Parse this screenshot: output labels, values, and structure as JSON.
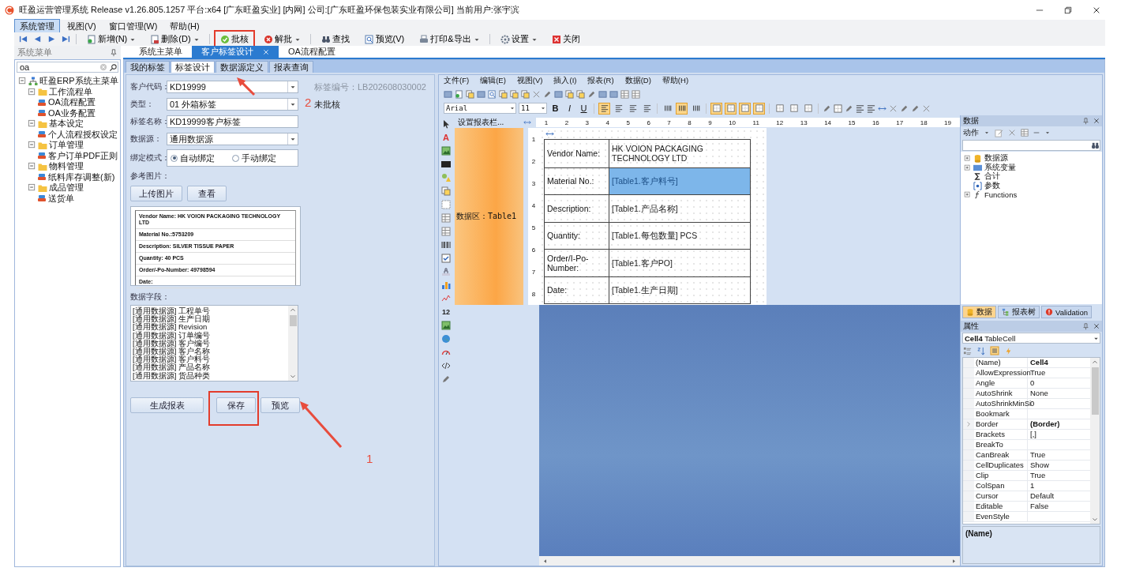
{
  "window": {
    "title": "旺盈运营管理系统 Release v1.26.805.1257 平台:x64  [广东旺盈实业] [内网] 公司:[广东旺盈环保包装实业有限公司] 当前用户:张宇滨"
  },
  "menu": [
    {
      "label": "系统管理",
      "selected": true
    },
    {
      "label": "视图(V)",
      "selected": false
    },
    {
      "label": "窗口管理(W)",
      "selected": false
    },
    {
      "label": "帮助(H)",
      "selected": false
    }
  ],
  "toolbar": [
    {
      "label": "新增(N)",
      "dropdown": true,
      "highlighted": false
    },
    {
      "label": "删除(D)",
      "dropdown": true,
      "highlighted": false
    },
    {
      "label": "批核",
      "dropdown": false,
      "highlighted": true
    },
    {
      "label": "解批",
      "dropdown": true,
      "highlighted": false
    },
    {
      "label": "查找",
      "dropdown": false,
      "highlighted": false
    },
    {
      "label": "预览(V)",
      "dropdown": false,
      "highlighted": false
    },
    {
      "label": "打印&导出",
      "dropdown": true,
      "highlighted": false
    },
    {
      "label": "设置",
      "dropdown": true,
      "highlighted": false
    },
    {
      "label": "关闭",
      "dropdown": false,
      "highlighted": false
    }
  ],
  "sidebar": {
    "title": "系统菜单",
    "search": {
      "value": "oa"
    },
    "tree": [
      {
        "label": "旺盈ERP系统主菜单",
        "kind": "root",
        "expanded": true,
        "children": [
          {
            "label": "工作流程单",
            "kind": "folder",
            "expanded": true,
            "children": [
              {
                "label": "OA流程配置",
                "kind": "leaf"
              },
              {
                "label": "OA业务配置",
                "kind": "leaf"
              }
            ]
          },
          {
            "label": "基本设定",
            "kind": "folder",
            "expanded": true,
            "children": [
              {
                "label": "个人流程授权设定",
                "kind": "leaf"
              }
            ]
          },
          {
            "label": "订单管理",
            "kind": "folder",
            "expanded": true,
            "children": [
              {
                "label": "客户订单PDF正则",
                "kind": "leaf"
              }
            ]
          },
          {
            "label": "物料管理",
            "kind": "folder",
            "expanded": true,
            "children": [
              {
                "label": "纸料库存调整(新)",
                "kind": "leaf"
              }
            ]
          },
          {
            "label": "成品管理",
            "kind": "folder",
            "expanded": true,
            "children": [
              {
                "label": "送货单",
                "kind": "leaf"
              }
            ]
          }
        ]
      }
    ]
  },
  "doc_tabs": [
    {
      "label": "系统主菜单",
      "selected": false,
      "closable": false
    },
    {
      "label": "客户标签设计",
      "selected": true,
      "closable": true
    },
    {
      "label": "OA流程配置",
      "selected": false,
      "closable": false
    }
  ],
  "inner_tabs": [
    {
      "label": "我的标签",
      "selected": false
    },
    {
      "label": "标签设计",
      "selected": true
    },
    {
      "label": "数据源定义",
      "selected": false
    },
    {
      "label": "报表查询",
      "selected": false
    }
  ],
  "form": {
    "fields": [
      {
        "label": "客户代码：",
        "kind": "select",
        "value": "KD19999"
      },
      {
        "label": "类型：",
        "kind": "select",
        "value": "01 外箱标签"
      },
      {
        "label": "标签名称：",
        "kind": "text",
        "value": "KD19999客户标签"
      },
      {
        "label": "数据源：",
        "kind": "select",
        "value": "通用数据源"
      },
      {
        "label": "绑定模式：",
        "kind": "radio",
        "options": [
          {
            "label": "自动绑定",
            "selected": true
          },
          {
            "label": "手动绑定",
            "selected": false
          }
        ]
      }
    ],
    "label_no": "标签编号：LB202608030002",
    "status": "未批核",
    "image_label": "参考图片：",
    "image_buttons": [
      "上传图片",
      "查看"
    ],
    "preview_lines": [
      "Vendor Name: HK VOION PACKAGING TECHNOLOGY LTD",
      "Material No.:5753209",
      "Description: SILVER TISSUE PAPER",
      "Quantity: 40 PCS",
      "Order/-Po-Number: 49798594",
      "Date:"
    ],
    "fields_label": "数据字段：",
    "data_fields": [
      "[通用数据源] 工程单号",
      "[通用数据源] 生产日期",
      "[通用数据源] Revision",
      "[通用数据源] 订单编号",
      "[通用数据源] 客户编号",
      "[通用数据源] 客户名称",
      "[通用数据源] 客户料号",
      "[通用数据源] 产品名称",
      "[通用数据源] 货品种类"
    ],
    "buttons": [
      {
        "label": "生成报表",
        "highlighted": false
      },
      {
        "label": "保存",
        "highlighted": true
      },
      {
        "label": "预览",
        "highlighted": false
      }
    ]
  },
  "designer": {
    "menu": [
      "文件(F)",
      "编辑(E)",
      "视图(V)",
      "插入(I)",
      "报表(R)",
      "数据(D)",
      "帮助(H)"
    ],
    "font": "Arial",
    "font_size": "11",
    "format_buttons": [
      {
        "kind": "letter",
        "glyph": "B",
        "selected": false
      },
      {
        "kind": "letter",
        "glyph": "I",
        "selected": false
      },
      {
        "kind": "letter",
        "glyph": "U",
        "selected": false
      },
      {
        "kind": "align",
        "selected": true
      },
      {
        "kind": "align",
        "selected": false
      },
      {
        "kind": "align",
        "selected": false
      },
      {
        "kind": "align",
        "selected": false
      },
      {
        "kind": "columns",
        "selected": false
      },
      {
        "kind": "columns",
        "selected": true
      },
      {
        "kind": "columns",
        "selected": false
      },
      {
        "kind": "border",
        "selected": true
      },
      {
        "kind": "border",
        "selected": true
      },
      {
        "kind": "border",
        "selected": true
      },
      {
        "kind": "border",
        "selected": true
      },
      {
        "kind": "border",
        "selected": false
      },
      {
        "kind": "border",
        "selected": false
      },
      {
        "kind": "border",
        "selected": false
      }
    ],
    "toolbox": [
      {
        "kind": "pointer"
      },
      {
        "kind": "letter",
        "glyph": "A"
      },
      {
        "kind": "image"
      },
      {
        "kind": "svg"
      },
      {
        "kind": "shape"
      },
      {
        "kind": "page"
      },
      {
        "kind": "panel"
      },
      {
        "kind": "table"
      },
      {
        "kind": "cross"
      },
      {
        "kind": "barcode"
      },
      {
        "kind": "check"
      },
      {
        "kind": "stamp"
      },
      {
        "kind": "chart"
      },
      {
        "kind": "spark"
      },
      {
        "kind": "letter",
        "glyph": "12"
      },
      {
        "kind": "image"
      },
      {
        "kind": "globe"
      },
      {
        "kind": "gauge"
      },
      {
        "kind": "code"
      },
      {
        "kind": "pen"
      }
    ],
    "band_header": "设置报表栏...",
    "band_label": "数据区：Table1",
    "ruler": [
      "1",
      "2",
      "3",
      "4",
      "5",
      "6",
      "7",
      "8",
      "9",
      "10",
      "11",
      "12",
      "13",
      "14",
      "15",
      "16",
      "17",
      "18",
      "19"
    ],
    "vruler": [
      "1",
      "2",
      "3",
      "4",
      "5",
      "6",
      "7",
      "8"
    ],
    "table": [
      {
        "label": "Vendor Name:",
        "value": "HK VOION PACKAGING TECHNOLOGY LTD",
        "selected": false
      },
      {
        "label": "Material No.:",
        "value": "[Table1.客户料号]",
        "selected": true
      },
      {
        "label": "Description:",
        "value": "[Table1.产品名称]",
        "selected": false
      },
      {
        "label": "Quantity:",
        "value": "[Table1.每包数量] PCS",
        "selected": false
      },
      {
        "label": "Order/I-Po-Number:",
        "value": "[Table1.客户PO]",
        "selected": false
      },
      {
        "label": "Date:",
        "value": "[Table1.生产日期]",
        "selected": false
      }
    ]
  },
  "data_panel": {
    "title": "数据",
    "actions": "动作",
    "tree": [
      {
        "label": "数据源",
        "kind": "database",
        "expanded": false
      },
      {
        "label": "系统变量",
        "kind": "variable",
        "expanded": false
      },
      {
        "label": "合计",
        "kind": "sum"
      },
      {
        "label": "参数",
        "kind": "param"
      },
      {
        "label": "Functions",
        "kind": "function",
        "expanded": false
      }
    ],
    "tabs": [
      {
        "label": "数据",
        "selected": true
      },
      {
        "label": "报表树",
        "selected": false
      },
      {
        "label": "Validation",
        "selected": false
      }
    ]
  },
  "properties": {
    "title": "属性",
    "object": "**Cell4**  TableCell",
    "rows": [
      {
        "name": "(Name)",
        "value": "Cell4",
        "bold": true,
        "expandable": false
      },
      {
        "name": "AllowExpression",
        "value": "True",
        "bold": false,
        "expandable": false
      },
      {
        "name": "Angle",
        "value": "0",
        "bold": false,
        "expandable": false
      },
      {
        "name": "AutoShrink",
        "value": "None",
        "bold": false,
        "expandable": false
      },
      {
        "name": "AutoShrinkMinSi",
        "value": "0",
        "bold": false,
        "expandable": false
      },
      {
        "name": "Bookmark",
        "expandable": false
      },
      {
        "name": "Border",
        "value": "(Border)",
        "bold": true,
        "expandable": true
      },
      {
        "name": "Brackets",
        "value": "[,]",
        "bold": false,
        "expandable": false
      },
      {
        "name": "BreakTo",
        "expandable": false
      },
      {
        "name": "CanBreak",
        "value": "True",
        "bold": false,
        "expandable": false
      },
      {
        "name": "CellDuplicates",
        "value": "Show",
        "bold": false,
        "expandable": false
      },
      {
        "name": "Clip",
        "value": "True",
        "bold": false,
        "expandable": false
      },
      {
        "name": "ColSpan",
        "value": "1",
        "bold": false,
        "expandable": false
      },
      {
        "name": "Cursor",
        "value": "Default",
        "bold": false,
        "expandable": false
      },
      {
        "name": "Editable",
        "value": "False",
        "bold": false,
        "expandable": false
      },
      {
        "name": "EvenStyle",
        "expandable": false
      }
    ],
    "description": "(Name)"
  },
  "annotations": [
    {
      "kind": "arrow"
    },
    {
      "kind": "number",
      "text": "2"
    },
    {
      "kind": "arrow"
    },
    {
      "kind": "number",
      "text": "1"
    }
  ]
}
